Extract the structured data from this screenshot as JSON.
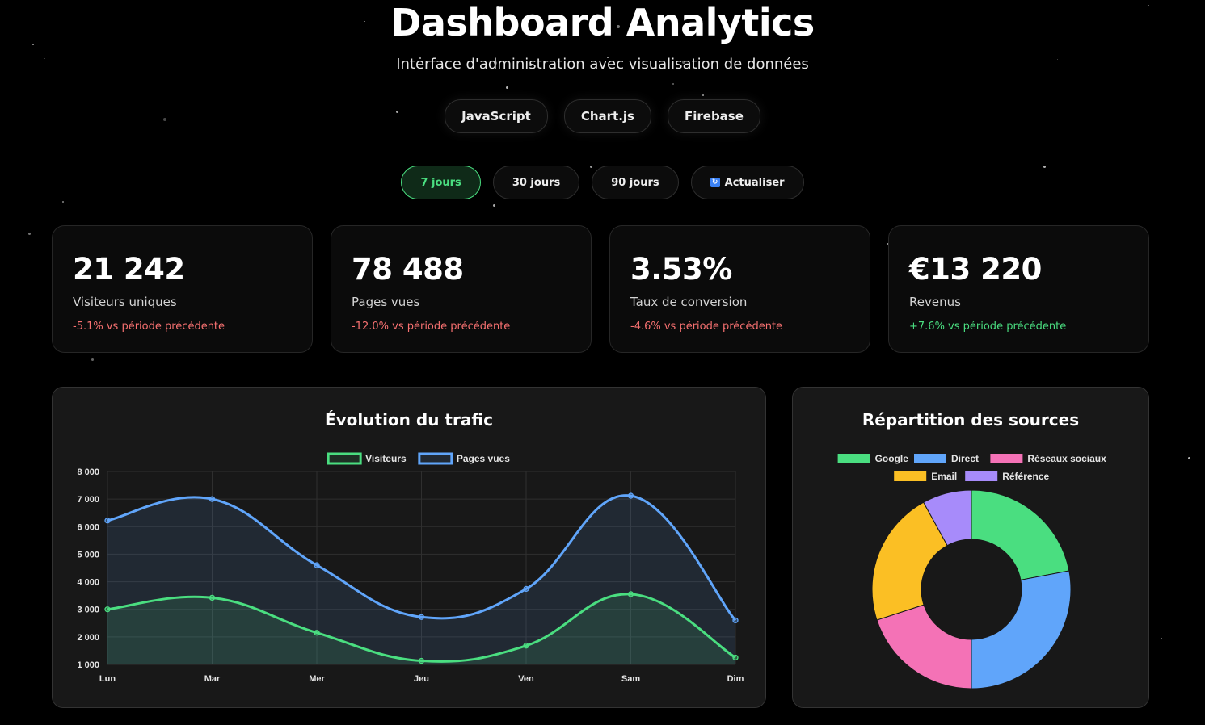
{
  "header": {
    "title": "Dashboard Analytics",
    "subtitle": "Interface d'administration avec visualisation de données"
  },
  "tech_tags": [
    "JavaScript",
    "Chart.js",
    "Firebase"
  ],
  "range_buttons": {
    "d7": "7 jours",
    "d30": "30 jours",
    "d90": "90 jours",
    "refresh": "Actualiser",
    "active": "7 jours"
  },
  "kpis": [
    {
      "value": "21 242",
      "label": "Visiteurs uniques",
      "change": "-5.1% vs période précédente",
      "trend": "down"
    },
    {
      "value": "78 488",
      "label": "Pages vues",
      "change": "-12.0% vs période précédente",
      "trend": "down"
    },
    {
      "value": "3.53%",
      "label": "Taux de conversion",
      "change": "-4.6% vs période précédente",
      "trend": "down"
    },
    {
      "value": "€13 220",
      "label": "Revenus",
      "change": "+7.6% vs période précédente",
      "trend": "up"
    }
  ],
  "colors": {
    "green": "#4ade80",
    "blue": "#60a5fa",
    "pink": "#f472b6",
    "yellow": "#fbbf24",
    "purple": "#a78bfa",
    "negative": "#f87171"
  },
  "chart_data": [
    {
      "type": "line",
      "title": "Évolution du trafic",
      "categories": [
        "Lun",
        "Mar",
        "Mer",
        "Jeu",
        "Ven",
        "Sam",
        "Dim"
      ],
      "series": [
        {
          "name": "Visiteurs",
          "values": [
            3000,
            3420,
            2150,
            1130,
            1680,
            3550,
            1250
          ],
          "color": "#4ade80"
        },
        {
          "name": "Pages vues",
          "values": [
            6220,
            7000,
            4600,
            2720,
            3740,
            7120,
            2600
          ],
          "color": "#60a5fa"
        }
      ],
      "y_ticks": [
        "1 000",
        "2 000",
        "3 000",
        "4 000",
        "5 000",
        "6 000",
        "7 000",
        "8 000"
      ],
      "ylim": [
        1000,
        8000
      ],
      "fill": true,
      "grid": true,
      "legend": "top"
    },
    {
      "type": "pie",
      "title": "Répartition des sources",
      "labels": [
        "Google",
        "Direct",
        "Réseaux sociaux",
        "Email",
        "Référence"
      ],
      "values": [
        22,
        28,
        20,
        22,
        8
      ],
      "colors": [
        "#4ade80",
        "#60a5fa",
        "#f472b6",
        "#fbbf24",
        "#a78bfa"
      ],
      "donut": true,
      "legend": "top"
    }
  ]
}
